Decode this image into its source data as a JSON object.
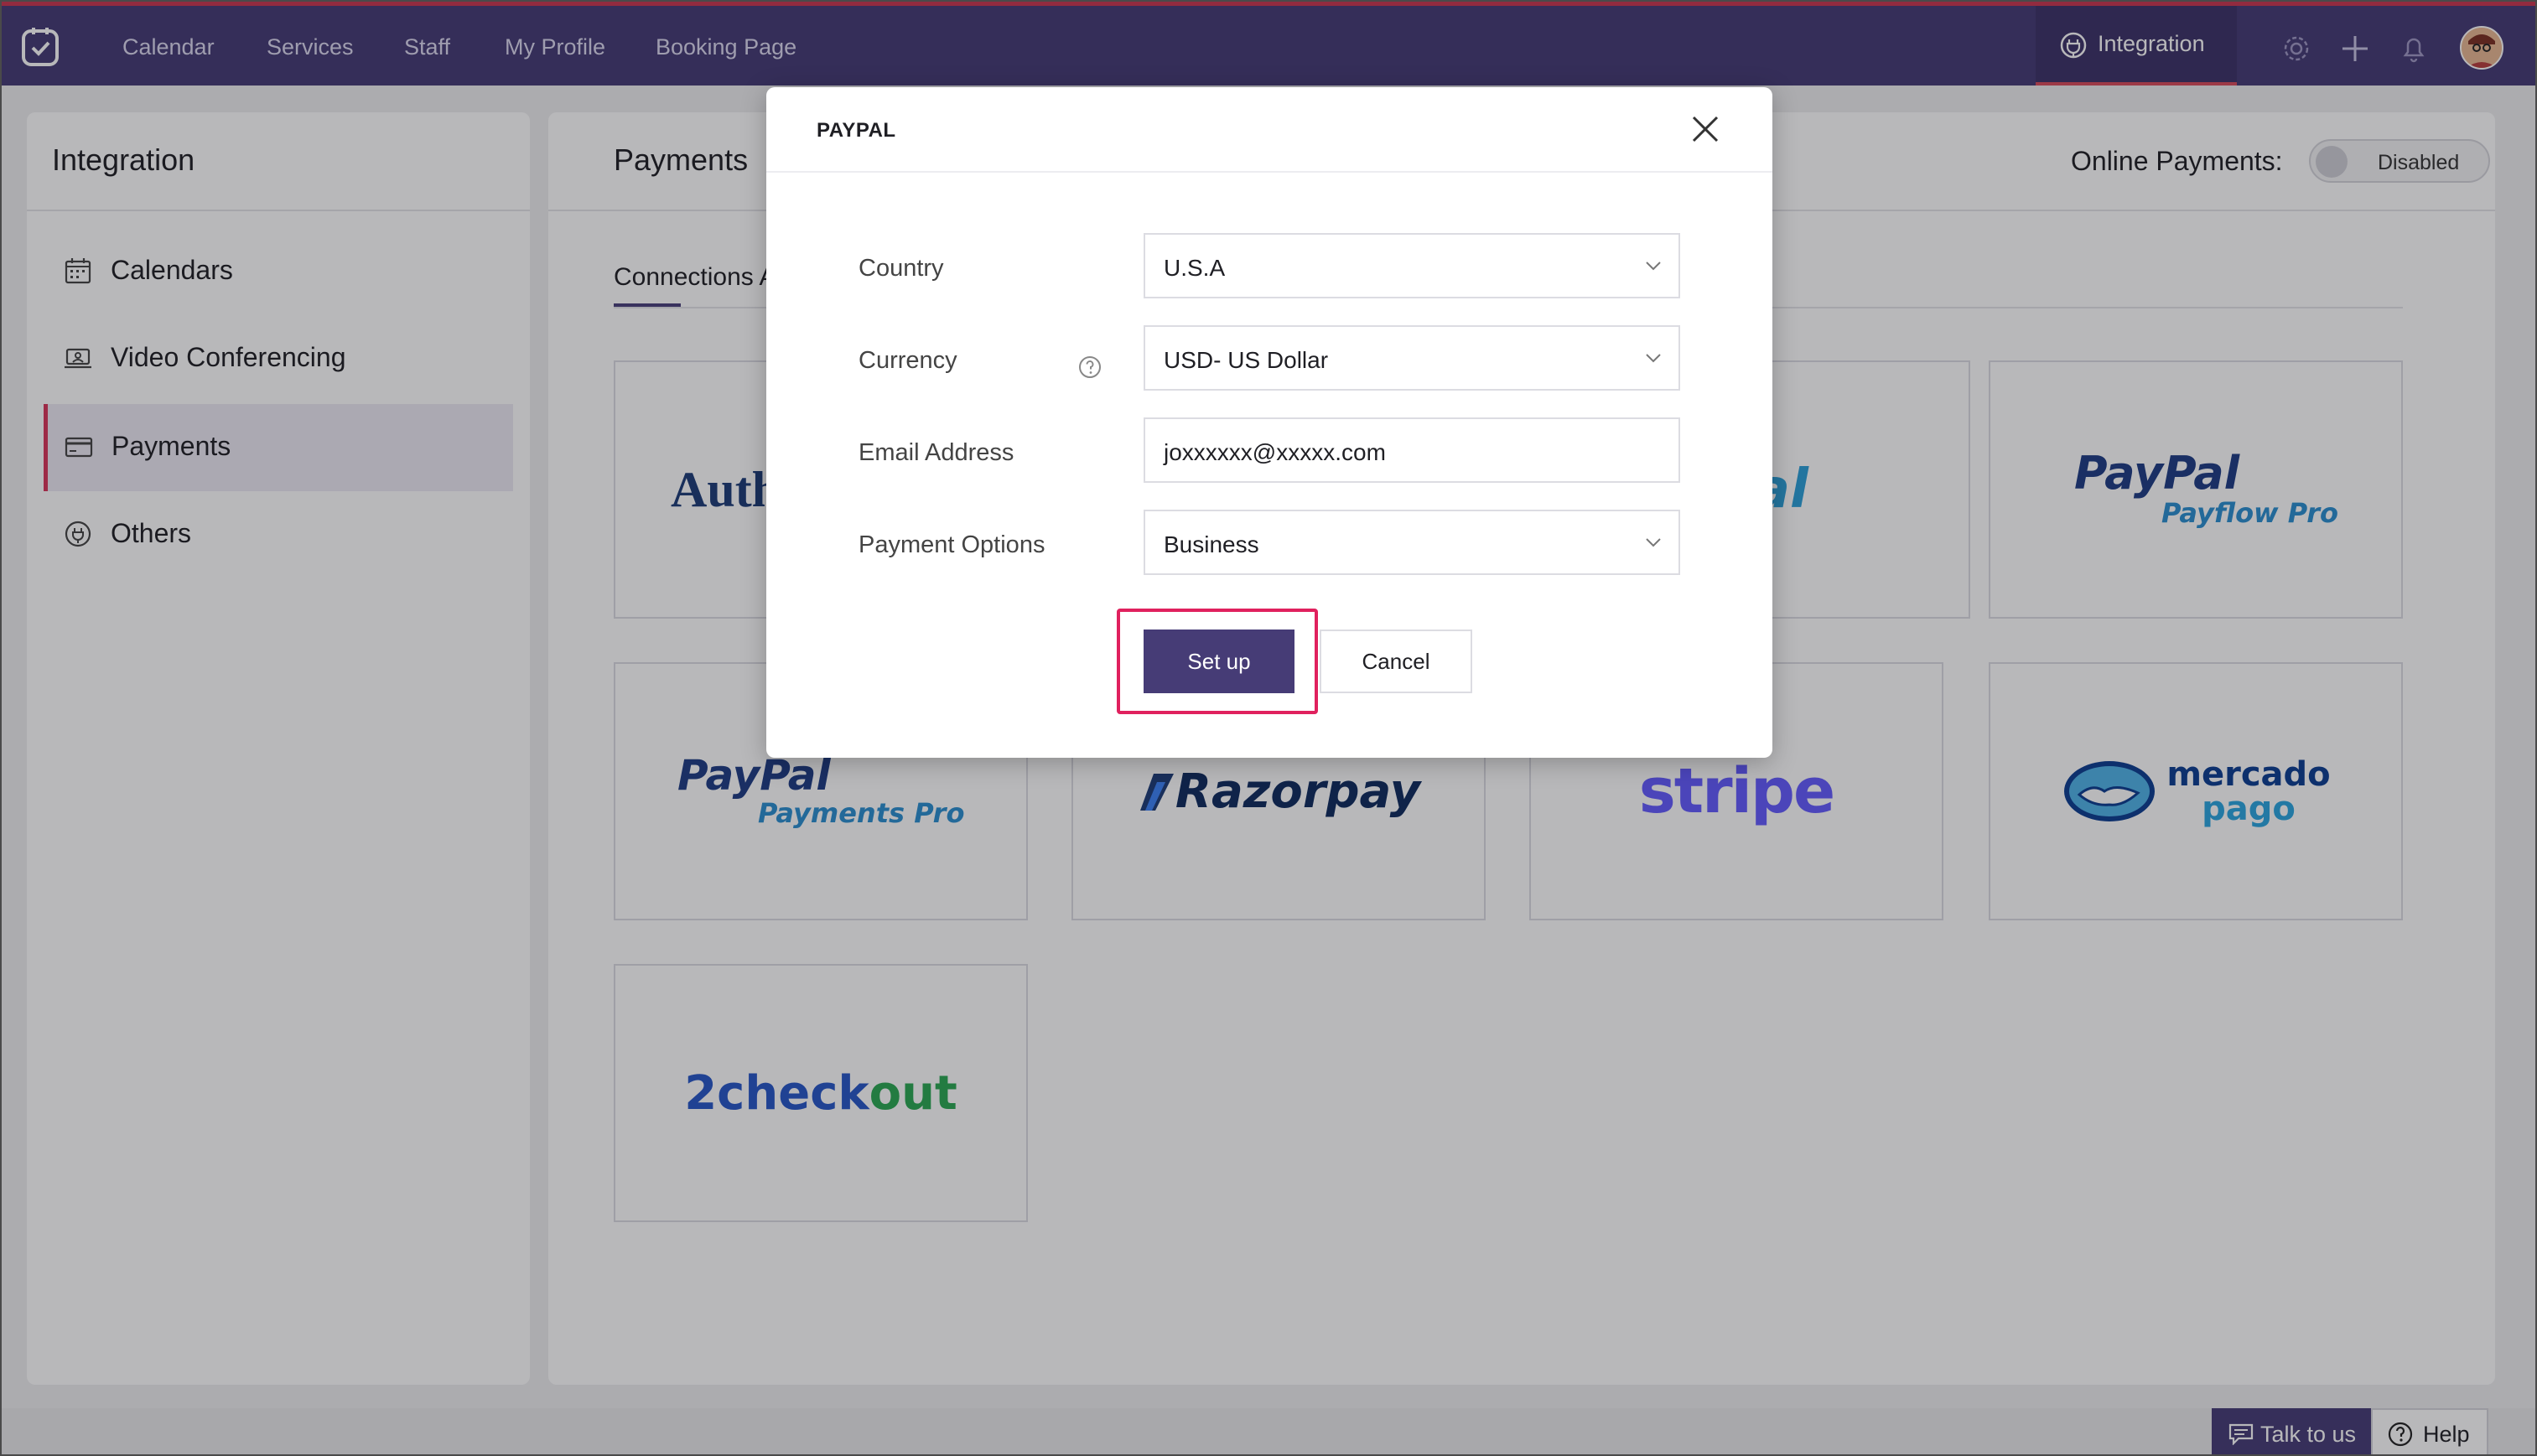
{
  "nav": {
    "items": [
      "Calendar",
      "Services",
      "Staff",
      "My Profile",
      "Booking Page"
    ],
    "active": "Integration"
  },
  "sidebar": {
    "title": "Integration",
    "items": [
      {
        "label": "Calendars",
        "icon": "calendar-icon"
      },
      {
        "label": "Video Conferencing",
        "icon": "video-conferencing-icon"
      },
      {
        "label": "Payments",
        "icon": "credit-card-icon",
        "active": true
      },
      {
        "label": "Others",
        "icon": "plug-icon"
      }
    ]
  },
  "main": {
    "title": "Payments",
    "online_payments_label": "Online Payments:",
    "online_payments_state": "Disabled",
    "tab_label": "Connections A"
  },
  "cards": [
    {
      "name": "Auth",
      "text": "Auth"
    },
    {
      "name": "PayPal",
      "text": "Pal"
    },
    {
      "name": "PayPal Payflow Pro",
      "line1": "PayPal",
      "line2": "Payflow Pro"
    },
    {
      "name": "PayPal Payments Pro",
      "line1": "PayPal",
      "line2": "Payments Pro"
    },
    {
      "name": "Razorpay",
      "text": "Razorpay"
    },
    {
      "name": "Stripe",
      "text": "stripe"
    },
    {
      "name": "Mercado Pago",
      "line1": "mercado",
      "line2": "pago"
    },
    {
      "name": "2checkout",
      "text_a": "2check",
      "text_b": "out"
    }
  ],
  "modal": {
    "title": "PAYPAL",
    "fields": [
      {
        "label": "Country",
        "value": "U.S.A",
        "type": "select"
      },
      {
        "label": "Currency",
        "value": "USD- US Dollar",
        "type": "select"
      },
      {
        "label": "Email Address",
        "value": "joxxxxxx@xxxxx.com",
        "type": "input"
      },
      {
        "label": "Payment Options",
        "value": "Business",
        "type": "select"
      }
    ],
    "setup_label": "Set up",
    "cancel_label": "Cancel"
  },
  "footer": {
    "talk_label": "Talk to us",
    "help_label": "Help"
  },
  "colors": {
    "nav_bg": "#443a74",
    "accent": "#463c76",
    "highlight": "#e0215e"
  }
}
